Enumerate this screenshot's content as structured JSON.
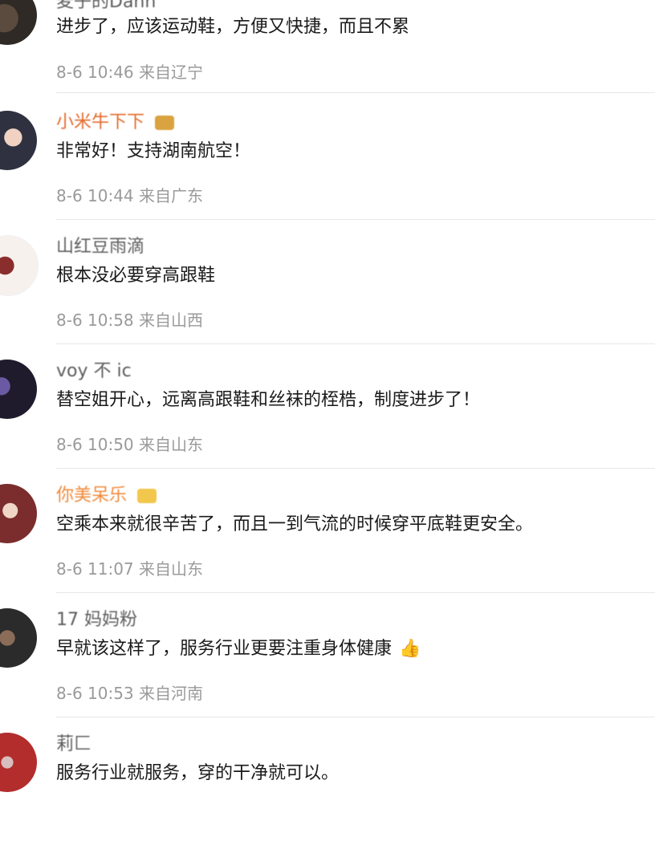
{
  "comments": [
    {
      "username": "麦子的Dann",
      "text": "进步了，应该运动鞋，方便又快捷，而且不累",
      "time": "8-6 10:46",
      "location": "来自辽宁"
    },
    {
      "username": "小米牛下下",
      "text": "非常好！支持湖南航空！",
      "time": "8-6 10:44",
      "location": "来自广东"
    },
    {
      "username": "山红豆雨滴",
      "text": "根本没必要穿高跟鞋",
      "time": "8-6 10:58",
      "location": "来自山西"
    },
    {
      "username": "voy 不 ic",
      "text": "替空姐开心，远离高跟鞋和丝袜的桎梏，制度进步了！",
      "time": "8-6 10:50",
      "location": "来自山东"
    },
    {
      "username": "你美呆乐",
      "text": "空乘本来就很辛苦了，而且一到气流的时候穿平底鞋更安全。",
      "time": "8-6 11:07",
      "location": "来自山东"
    },
    {
      "username": "17 妈妈粉",
      "text": "早就该这样了，服务行业更要注重身体健康",
      "time": "8-6 10:53",
      "location": "来自河南"
    },
    {
      "username": "莉匚 ",
      "text": "服务行业就服务，穿的干净就可以。",
      "time": "",
      "location": ""
    }
  ],
  "colors": {
    "text": "#1a1a1a",
    "meta": "#9a9a9a",
    "divider": "#e7e7e7",
    "badge_gold": "#d9a341",
    "badge_orange": "#f08a3c"
  },
  "icons": {
    "thumbs_up": "thumbs-up-emoji",
    "vip_badge": "vip-crown-badge"
  }
}
